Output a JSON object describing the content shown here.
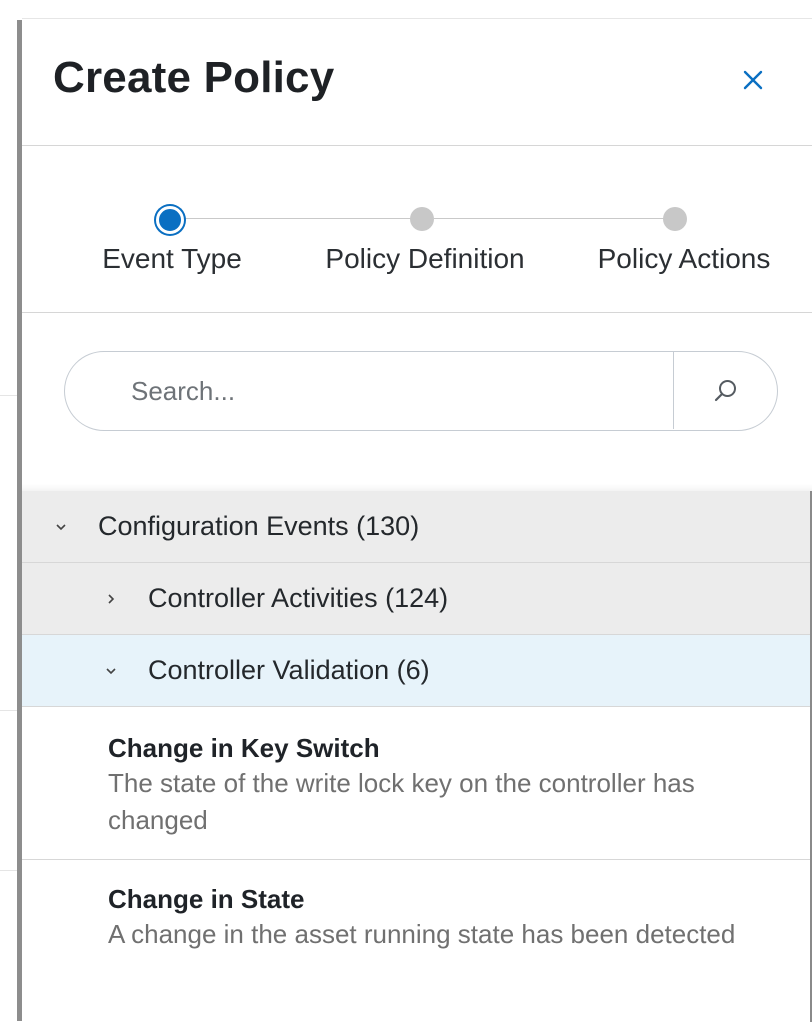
{
  "drawer": {
    "title": "Create Policy",
    "close_icon": "close-icon"
  },
  "stepper": {
    "steps": [
      {
        "label": "Event Type",
        "state": "active"
      },
      {
        "label": "Policy Definition",
        "state": "pending"
      },
      {
        "label": "Policy Actions",
        "state": "pending"
      }
    ]
  },
  "search": {
    "placeholder": "Search...",
    "value": "",
    "icon": "search-icon"
  },
  "tree": {
    "groups": [
      {
        "label": "Configuration Events (130)",
        "expanded": true
      },
      {
        "label": "Controller Activities (124)",
        "expanded": false
      },
      {
        "label": "Controller Validation (6)",
        "expanded": true,
        "selected": true
      }
    ],
    "events": [
      {
        "title": "Change in Key Switch",
        "description": "The state of the write lock key on the controller has changed"
      },
      {
        "title": "Change in State",
        "description": "A change in the asset running state has been detected"
      }
    ]
  },
  "colors": {
    "accent": "#0a6fc2",
    "pending_step": "#c8c8c8",
    "group_bg": "#ececec",
    "selected_bg": "#e7f3fa"
  }
}
